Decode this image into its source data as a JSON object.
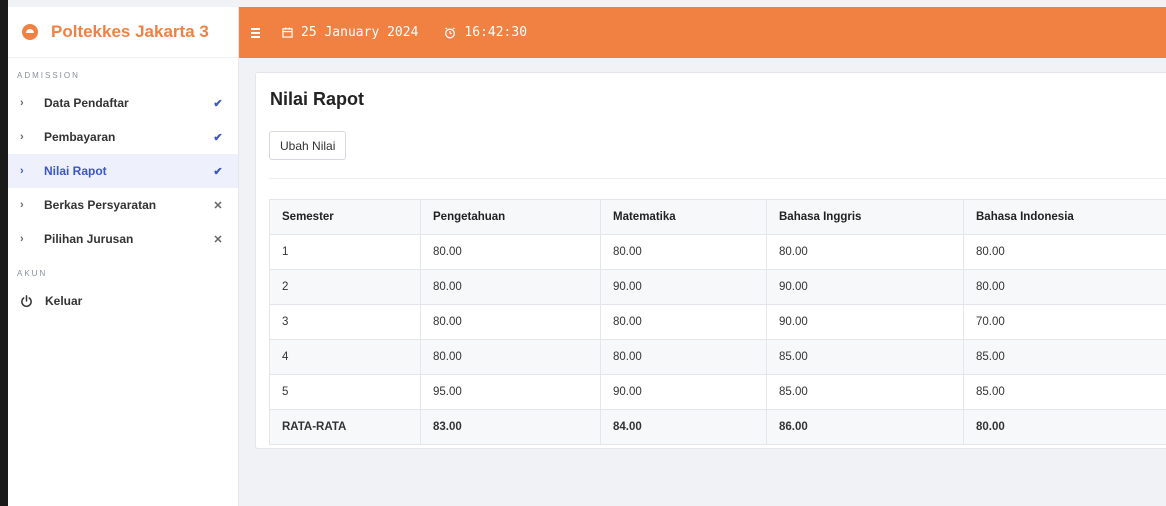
{
  "brand": {
    "name": "Poltekkes Jakarta 3"
  },
  "sidebar": {
    "section_admission": "ADMISSION",
    "items": [
      {
        "label": "Data Pendaftar",
        "status": "check",
        "status_glyph": "✔"
      },
      {
        "label": "Pembayaran",
        "status": "check",
        "status_glyph": "✔"
      },
      {
        "label": "Nilai Rapot",
        "status": "check",
        "status_glyph": "✔",
        "active": true
      },
      {
        "label": "Berkas Persyaratan",
        "status": "cross",
        "status_glyph": "✕"
      },
      {
        "label": "Pilihan Jurusan",
        "status": "cross",
        "status_glyph": "✕"
      }
    ],
    "section_akun": "AKUN",
    "logout_label": "Keluar"
  },
  "topbar": {
    "date": "25 January 2024",
    "time": "16:42:30",
    "background_color": "#f08142"
  },
  "main": {
    "title": "Nilai Rapot",
    "button_label": "Ubah Nilai",
    "table": {
      "headers": [
        "Semester",
        "Pengetahuan",
        "Matematika",
        "Bahasa Inggris",
        "Bahasa Indonesia"
      ],
      "rows": [
        [
          "1",
          "80.00",
          "80.00",
          "80.00",
          "80.00"
        ],
        [
          "2",
          "80.00",
          "90.00",
          "90.00",
          "80.00"
        ],
        [
          "3",
          "80.00",
          "80.00",
          "90.00",
          "70.00"
        ],
        [
          "4",
          "80.00",
          "80.00",
          "85.00",
          "85.00"
        ],
        [
          "5",
          "95.00",
          "90.00",
          "85.00",
          "85.00"
        ]
      ],
      "average": [
        "RATA-RATA",
        "83.00",
        "84.00",
        "86.00",
        "80.00"
      ]
    }
  },
  "colors": {
    "accent": "#f08142",
    "active": "#3b56c7"
  }
}
